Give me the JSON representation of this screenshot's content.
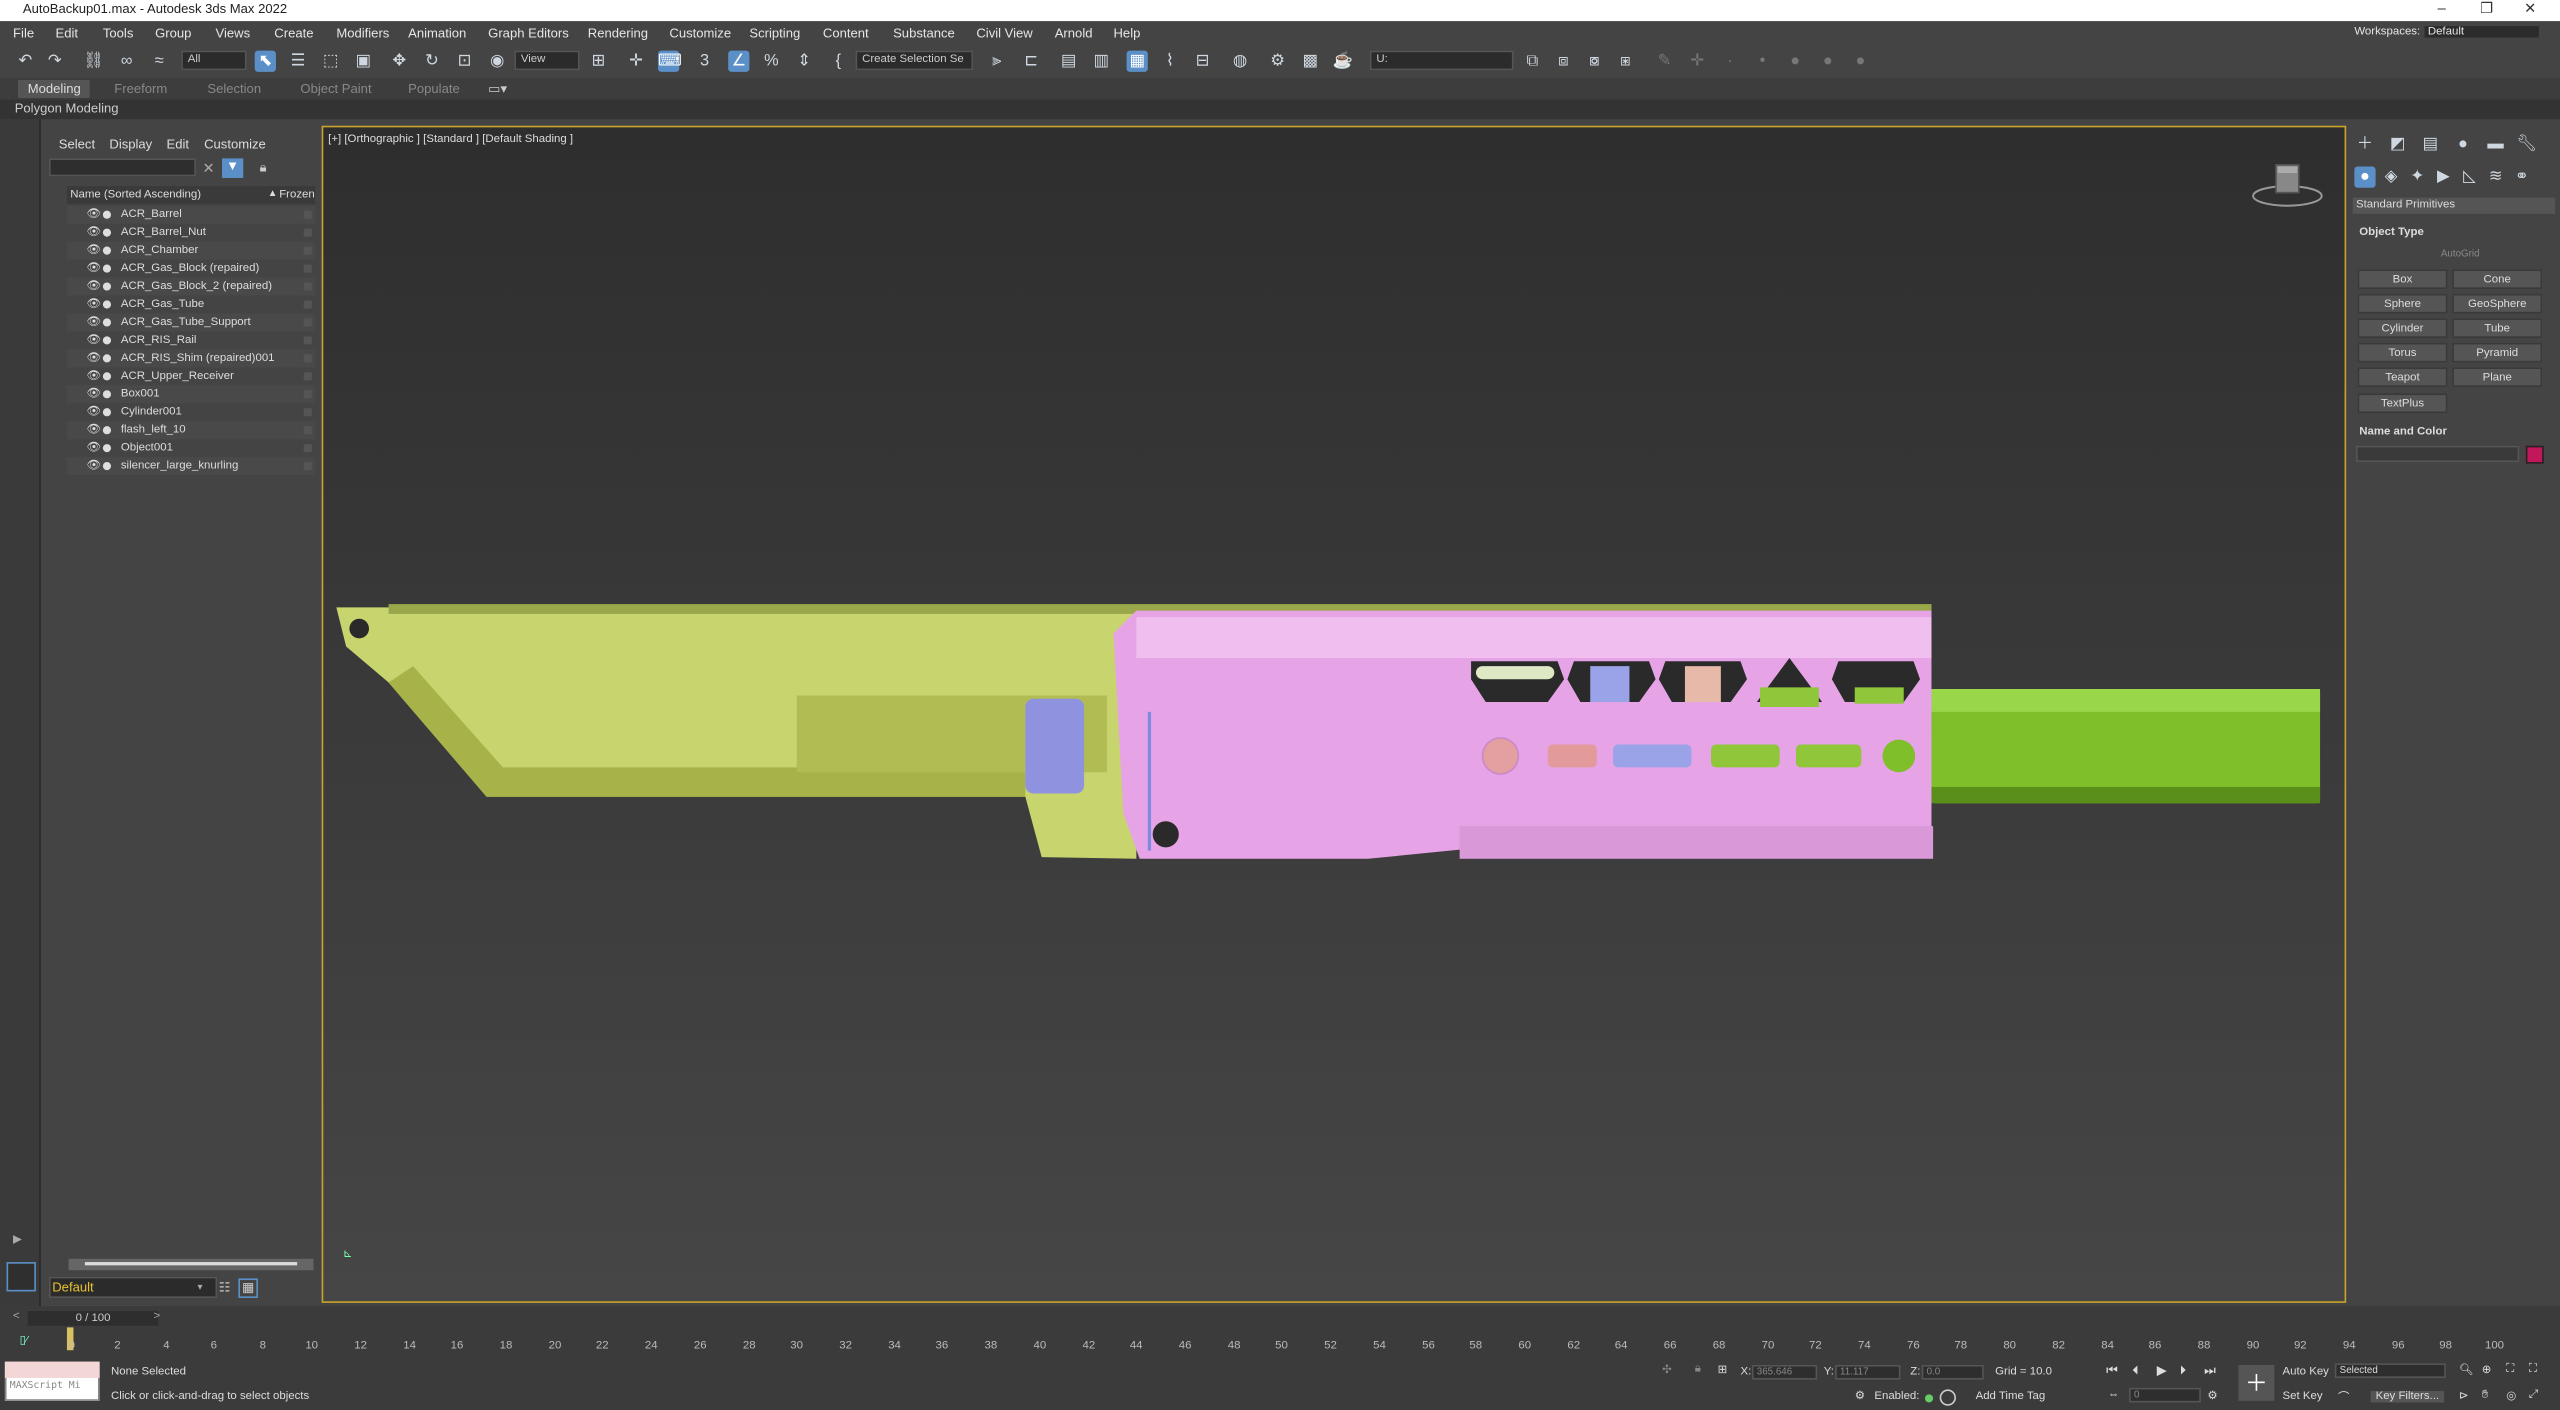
{
  "window": {
    "title": "AutoBackup01.max - Autodesk 3ds Max 2022",
    "workspaces_label": "Workspaces:",
    "workspace": "Default"
  },
  "menus": [
    "File",
    "Edit",
    "Tools",
    "Group",
    "Views",
    "Create",
    "Modifiers",
    "Animation",
    "Graph Editors",
    "Rendering",
    "Customize",
    "Scripting",
    "Content",
    "Substance",
    "Civil View",
    "Arnold",
    "Help"
  ],
  "toolbar": {
    "filter": "All",
    "ref_coord": "View",
    "selection_set": "Create Selection Se",
    "named_sel": "U:"
  },
  "ribbon": {
    "tabs": [
      "Modeling",
      "Freeform",
      "Selection",
      "Object Paint",
      "Populate"
    ],
    "active": "Modeling",
    "sub": "Polygon Modeling"
  },
  "explorer": {
    "tabs": [
      "Select",
      "Display",
      "Edit",
      "Customize"
    ],
    "col_name": "Name (Sorted Ascending)",
    "col_frozen": "Frozen",
    "items": [
      "ACR_Barrel",
      "ACR_Barrel_Nut",
      "ACR_Chamber",
      "ACR_Gas_Block (repaired)",
      "ACR_Gas_Block_2 (repaired)",
      "ACR_Gas_Tube",
      "ACR_Gas_Tube_Support",
      "ACR_RIS_Rail",
      "ACR_RIS_Shim (repaired)001",
      "ACR_Upper_Receiver",
      "Box001",
      "Cylinder001",
      "flash_left_10",
      "Object001",
      "silencer_large_knurling"
    ],
    "layer": "Default"
  },
  "viewport": {
    "label": "[+] [Orthographic ] [Standard ] [Default Shading ]"
  },
  "command_panel": {
    "dropdown": "Standard Primitives",
    "object_type": "Object Type",
    "autogrid": "AutoGrid",
    "buttons": [
      "Box",
      "Cone",
      "Sphere",
      "GeoSphere",
      "Cylinder",
      "Tube",
      "Torus",
      "Pyramid",
      "Teapot",
      "Plane",
      "TextPlus"
    ],
    "name_color": "Name and Color",
    "swatch_color": "#c2185b"
  },
  "timeline": {
    "counter": "0 / 100",
    "ticks": [
      "0",
      "2",
      "4",
      "6",
      "8",
      "10",
      "12",
      "14",
      "16",
      "18",
      "20",
      "22",
      "24",
      "26",
      "28",
      "30",
      "32",
      "34",
      "36",
      "38",
      "40",
      "42",
      "44",
      "46",
      "48",
      "50",
      "52",
      "54",
      "56",
      "58",
      "60",
      "62",
      "64",
      "66",
      "68",
      "70",
      "72",
      "74",
      "76",
      "78",
      "80",
      "82",
      "84",
      "86",
      "88",
      "90",
      "92",
      "94",
      "96",
      "98",
      "100"
    ]
  },
  "status": {
    "maxscript": "MAXScript Mi",
    "selection": "None Selected",
    "prompt": "Click or click-and-drag to select objects",
    "x_label": "X:",
    "x": "365.646",
    "y_label": "Y:",
    "y": "11.117",
    "z_label": "Z:",
    "z": "0.0",
    "grid": "Grid = 10.0",
    "enabled": "Enabled:",
    "add_time_tag": "Add Time Tag",
    "auto_key": "Auto Key",
    "set_key": "Set Key",
    "selected": "Selected",
    "key_filters": "Key Filters...",
    "frame": "0"
  }
}
